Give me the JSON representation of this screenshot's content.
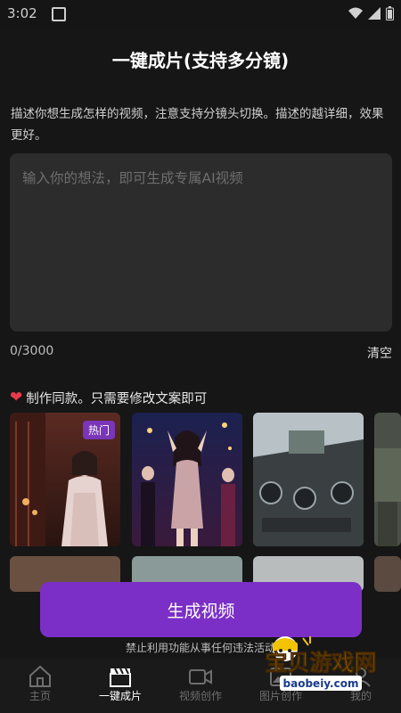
{
  "status_bar": {
    "time": "3:02"
  },
  "page": {
    "title": "一键成片(支持多分镜)",
    "instruction": "描述你想生成怎样的视频，注意支持分镜头切换。描述的越详细，效果更好。",
    "prompt_placeholder": "输入你的想法，即可生成专属AI视频",
    "char_count": "0/3000",
    "clear_label": "清空"
  },
  "templates": {
    "header": "制作同款。只需要修改文案即可",
    "hot_badge": "热门"
  },
  "generate_button": "生成视频",
  "disclaimer": "禁止利用功能从事任何违法活动",
  "tabs": [
    {
      "label": "主页",
      "icon": "home-icon",
      "active": false
    },
    {
      "label": "一键成片",
      "icon": "clapperboard-icon",
      "active": true
    },
    {
      "label": "视频创作",
      "icon": "video-camera-icon",
      "active": false
    },
    {
      "label": "图片创作",
      "icon": "image-icon",
      "active": false
    },
    {
      "label": "我的",
      "icon": "user-icon",
      "active": false
    }
  ],
  "watermark": {
    "title": "宝贝游戏网",
    "url": "baobeiy.com"
  },
  "colors": {
    "accent": "#7b2fc6",
    "badge": "#7a35b8",
    "heart": "#e83a4a",
    "background": "#161616"
  }
}
